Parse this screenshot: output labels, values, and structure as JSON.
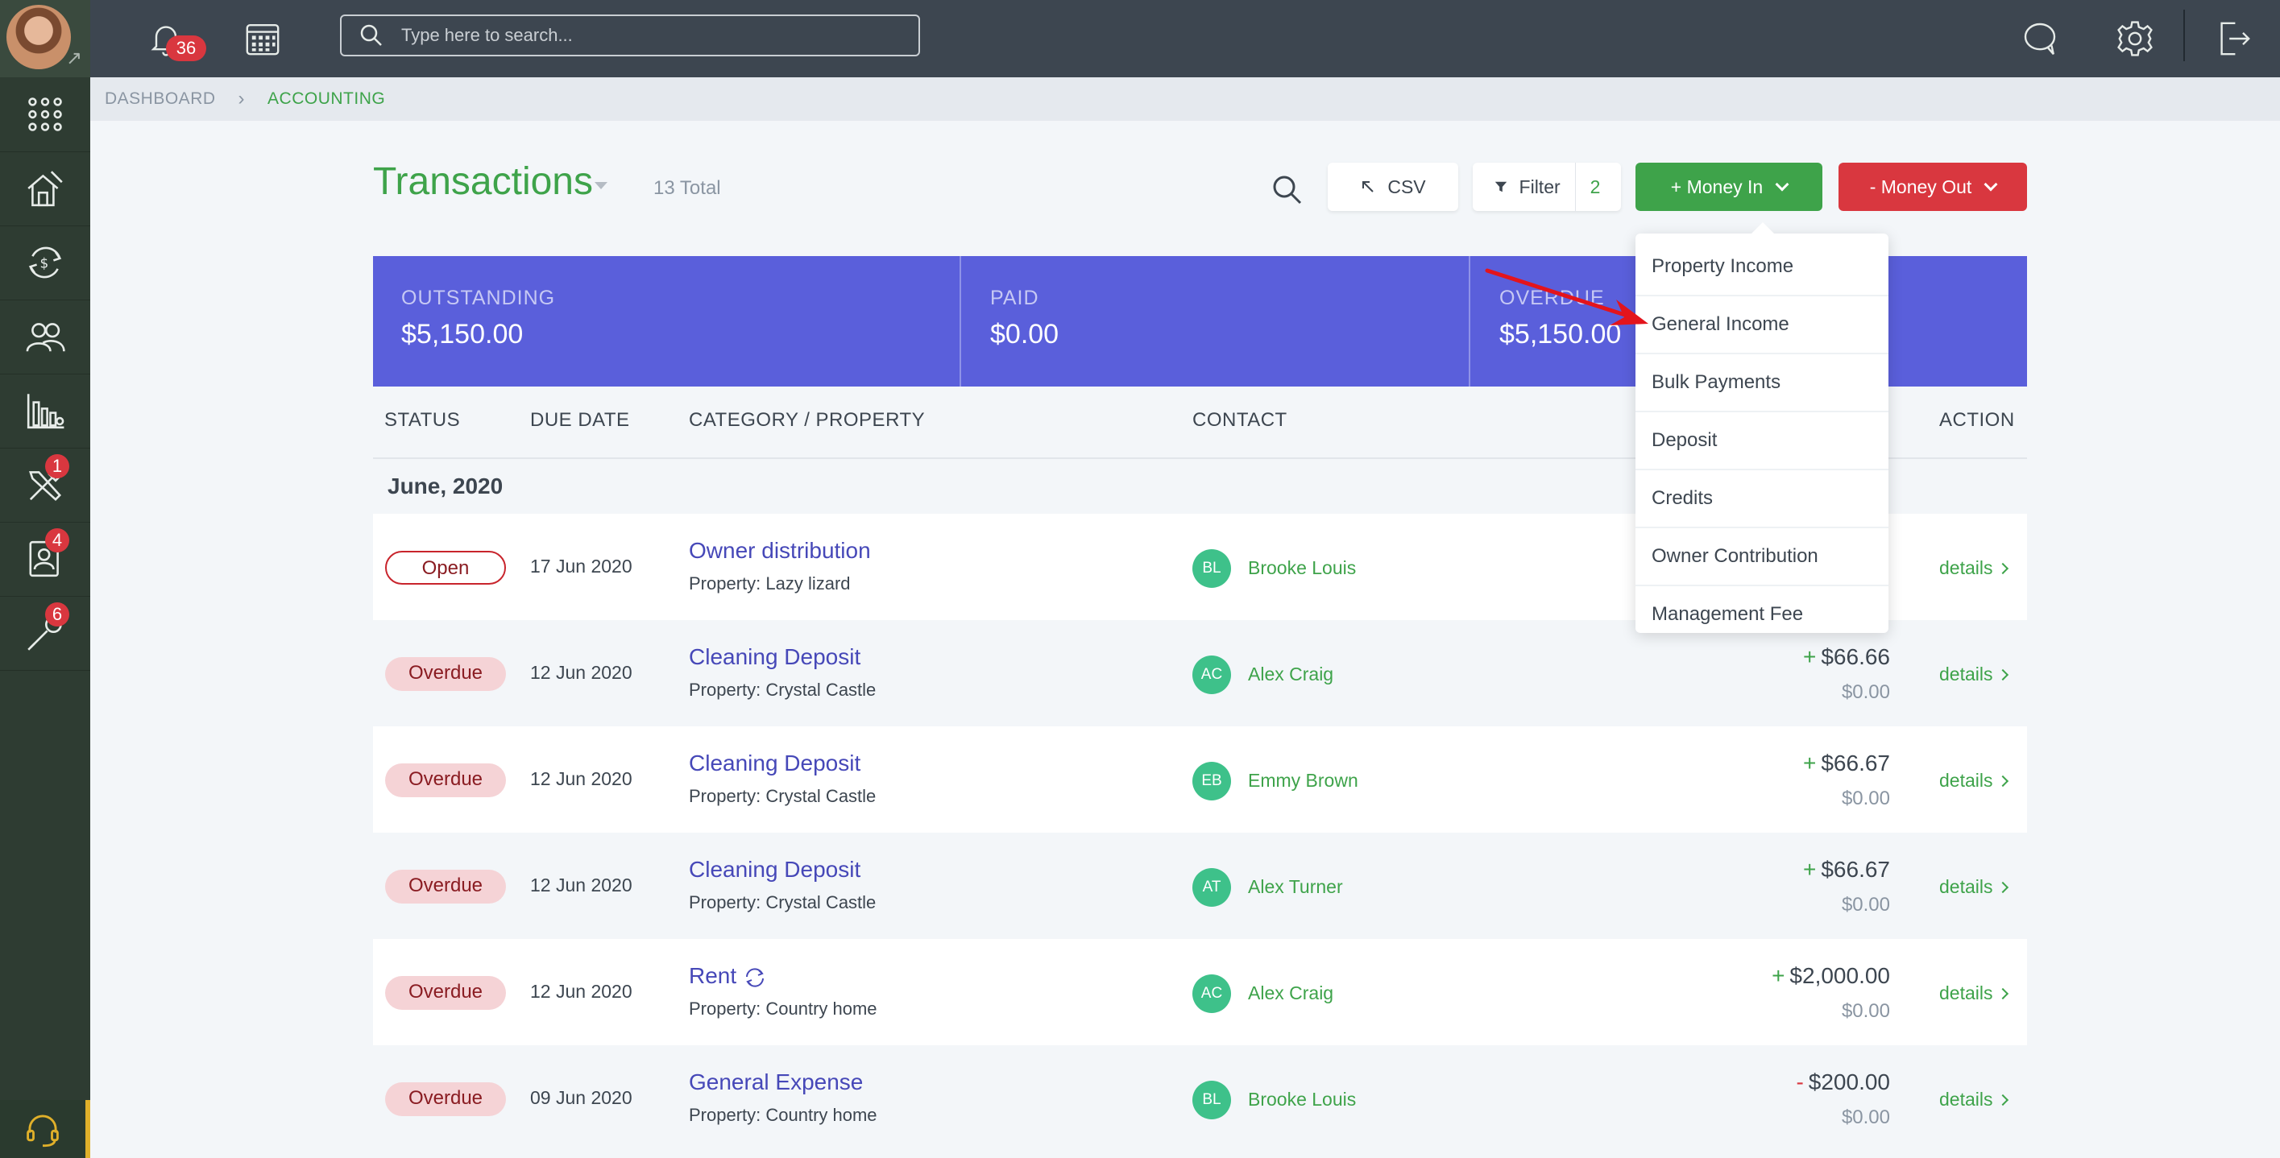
{
  "topbar": {
    "notification_count": "36",
    "search_placeholder": "Type here to search..."
  },
  "sidebar": {
    "items": [
      {
        "name": "apps",
        "badge": ""
      },
      {
        "name": "properties",
        "badge": ""
      },
      {
        "name": "accounting",
        "badge": ""
      },
      {
        "name": "contacts",
        "badge": ""
      },
      {
        "name": "reports",
        "badge": ""
      },
      {
        "name": "maintenance",
        "badge": "1"
      },
      {
        "name": "leasing",
        "badge": "4"
      },
      {
        "name": "tools",
        "badge": "6"
      }
    ]
  },
  "breadcrumb": {
    "root": "DASHBOARD",
    "current": "ACCOUNTING"
  },
  "header": {
    "title": "Transactions",
    "total": "13 Total",
    "csv_label": "CSV",
    "filter_label": "Filter",
    "filter_count": "2",
    "money_in_label": "+ Money In",
    "money_out_label": "- Money Out"
  },
  "summary": {
    "outstanding_label": "OUTSTANDING",
    "outstanding_value": "$5,150.00",
    "paid_label": "PAID",
    "paid_value": "$0.00",
    "overdue_label": "OVERDUE",
    "overdue_value": "$5,150.00"
  },
  "table": {
    "headers": [
      "STATUS",
      "DUE DATE",
      "CATEGORY / PROPERTY",
      "CONTACT",
      "ACTION"
    ],
    "group": "June, 2020",
    "details_label": "details",
    "rows": [
      {
        "status": "Open",
        "due": "17 Jun 2020",
        "category": "Owner distribution",
        "property": "Property: Lazy lizard",
        "initials": "BL",
        "contact": "Brooke Louis",
        "sign": "",
        "amount": "",
        "paid": ""
      },
      {
        "status": "Overdue",
        "due": "12 Jun 2020",
        "category": "Cleaning Deposit",
        "property": "Property: Crystal Castle",
        "initials": "AC",
        "contact": "Alex Craig",
        "sign": "+",
        "amount": "$66.66",
        "paid": "$0.00"
      },
      {
        "status": "Overdue",
        "due": "12 Jun 2020",
        "category": "Cleaning Deposit",
        "property": "Property: Crystal Castle",
        "initials": "EB",
        "contact": "Emmy Brown",
        "sign": "+",
        "amount": "$66.67",
        "paid": "$0.00"
      },
      {
        "status": "Overdue",
        "due": "12 Jun 2020",
        "category": "Cleaning Deposit",
        "property": "Property: Crystal Castle",
        "initials": "AT",
        "contact": "Alex Turner",
        "sign": "+",
        "amount": "$66.67",
        "paid": "$0.00"
      },
      {
        "status": "Overdue",
        "due": "12 Jun 2020",
        "category": "Rent",
        "property": "Property: Country home",
        "initials": "AC",
        "contact": "Alex Craig",
        "sign": "+",
        "amount": "$2,000.00",
        "paid": "$0.00"
      },
      {
        "status": "Overdue",
        "due": "09 Jun 2020",
        "category": "General Expense",
        "property": "Property: Country home",
        "initials": "BL",
        "contact": "Brooke Louis",
        "sign": "-",
        "amount": "$200.00",
        "paid": "$0.00"
      }
    ]
  },
  "money_in_menu": {
    "items": [
      "Property Income",
      "General Income",
      "Bulk Payments",
      "Deposit",
      "Credits",
      "Owner Contribution",
      "Management Fee"
    ]
  },
  "colors": {
    "accent_green": "#3ea34a",
    "danger_red": "#d9373f",
    "summary_purple": "#5a5fdb",
    "topbar": "#3d4650",
    "sidebar": "#2e3c32"
  }
}
